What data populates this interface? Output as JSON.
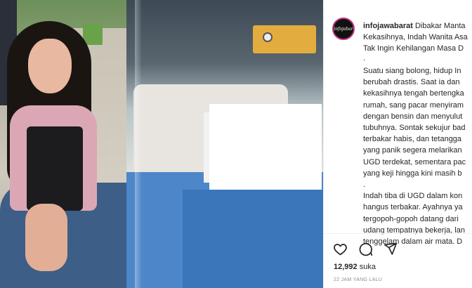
{
  "post": {
    "username": "infojawabarat",
    "avatar_logo": "infojabar",
    "caption_head": [
      "Dibakar Manta",
      "Kekasihnya, Indah Wanita Asa",
      "Tak Ingin Kehilangan Masa D"
    ],
    "caption_body": [
      ".",
      "Suatu siang bolong, hidup In",
      "berubah drastis. Saat ia dan",
      "kekasihnya tengah bertengka",
      "rumah, sang pacar menyiram",
      "dengan bensin dan menyulut",
      "tubuhnya. Sontak sekujur bad",
      "terbakar habis, dan tetangga",
      "yang panik segera melarikan",
      "UGD terdekat, sementara pac",
      "yang keji hingga kini masih b",
      ".",
      "Indah tiba di UGD dalam kon",
      "hangus terbakar. Ayahnya ya",
      "tergopoh-gopoh datang dari",
      "udang tempatnya bekerja, lan",
      "tenggelam dalam air mata. D"
    ],
    "likes_count": "12,992",
    "likes_label": "suka",
    "timestamp": "22 JAM YANG LALU"
  },
  "icons": {
    "like": "heart-icon",
    "comment": "comment-icon",
    "share": "share-icon"
  },
  "colors": {
    "text": "#262626",
    "muted": "#8e8e8e",
    "avatar_ring": "#c13584"
  }
}
